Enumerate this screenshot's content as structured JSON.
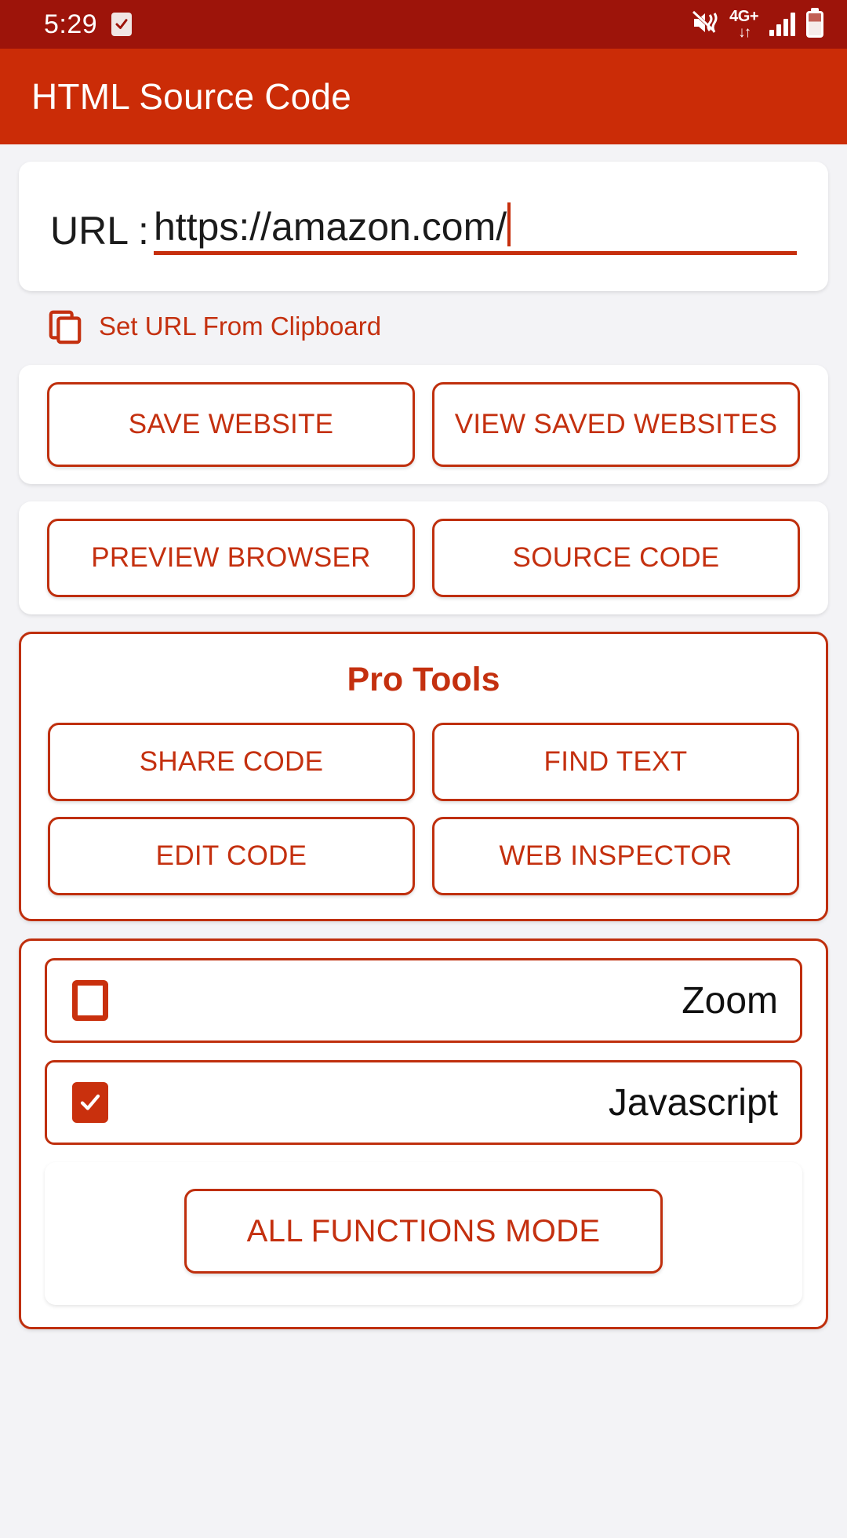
{
  "status_bar": {
    "time": "5:29",
    "tasks_icon": "checkbox-tasks-icon",
    "mute_icon": "vibrate-mute-icon",
    "network_label": "4G+",
    "network_arrows": "↓↑",
    "signal_icon": "signal-bars-icon",
    "battery_icon": "battery-icon",
    "background_color": "#9d140a"
  },
  "app_bar": {
    "title": "HTML Source Code",
    "background_color": "#cb2c07",
    "text_color": "#ffffff"
  },
  "url_field": {
    "label": "URL :",
    "value": "https://amazon.com/",
    "placeholder": "https://",
    "underline_color": "#c62f0d",
    "caret_color": "#c62f0d"
  },
  "clipboard": {
    "icon": "copy-clipboard-icon",
    "label": "Set URL From Clipboard"
  },
  "primary_actions": [
    {
      "label": "SAVE WEBSITE"
    },
    {
      "label": "VIEW SAVED WEBSITES"
    }
  ],
  "secondary_actions": [
    {
      "label": "PREVIEW BROWSER"
    },
    {
      "label": "SOURCE CODE"
    }
  ],
  "pro_tools": {
    "title": "Pro Tools",
    "buttons": [
      {
        "label": "SHARE CODE"
      },
      {
        "label": "FIND TEXT"
      },
      {
        "label": "EDIT CODE"
      },
      {
        "label": "WEB INSPECTOR"
      }
    ]
  },
  "options": {
    "checkboxes": [
      {
        "label": "Zoom",
        "checked": false
      },
      {
        "label": "Javascript",
        "checked": true
      }
    ],
    "all_functions_button": {
      "label": "ALL FUNCTIONS MODE"
    }
  },
  "theme": {
    "accent": "#c4300f",
    "border": "#bf2f0d",
    "page_background": "#f3f3f6",
    "card_background": "#ffffff",
    "text_dark": "#1b1b1b"
  }
}
